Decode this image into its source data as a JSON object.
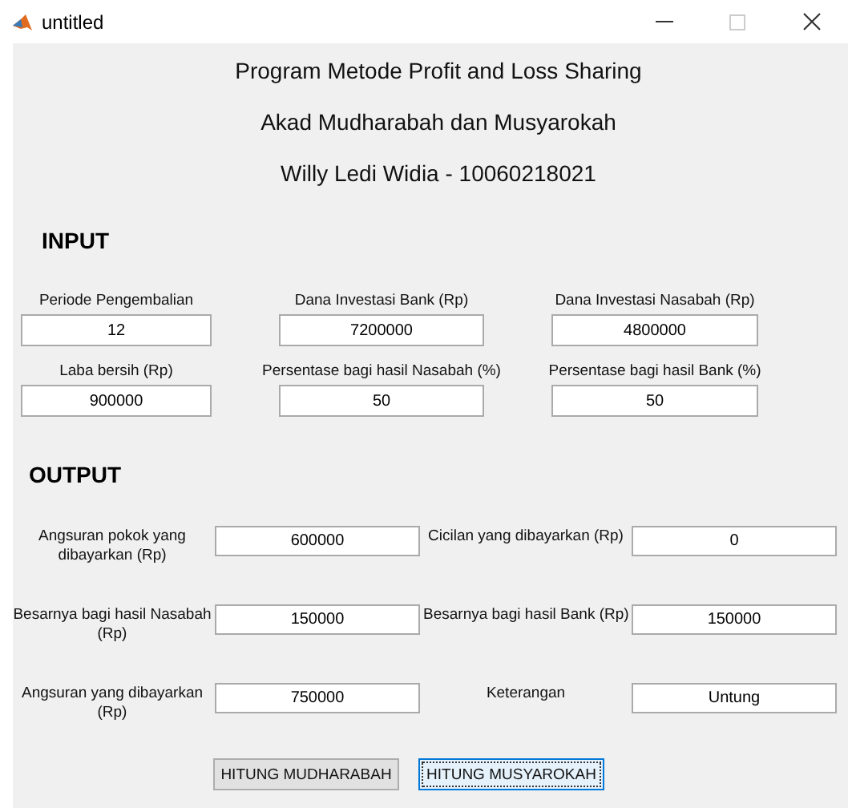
{
  "window": {
    "title": "untitled"
  },
  "titles": [
    "Program Metode Profit and Loss Sharing",
    "Akad Mudharabah dan Musyarokah",
    "Willy Ledi Widia - 10060218021"
  ],
  "input": {
    "heading": "INPUT",
    "fields": [
      {
        "label": "Periode Pengembalian",
        "value": "12"
      },
      {
        "label": "Dana Investasi Bank (Rp)",
        "value": "7200000"
      },
      {
        "label": "Dana Investasi Nasabah (Rp)",
        "value": "4800000"
      },
      {
        "label": "Laba bersih (Rp)",
        "value": "900000"
      },
      {
        "label": "Persentase bagi hasil Nasabah (%)",
        "value": "50"
      },
      {
        "label": "Persentase bagi hasil Bank (%)",
        "value": "50"
      }
    ]
  },
  "output": {
    "heading": "OUTPUT",
    "fields": [
      {
        "label": "Angsuran pokok yang dibayarkan (Rp)",
        "value": "600000"
      },
      {
        "label": "Cicilan yang dibayarkan (Rp)",
        "value": "0"
      },
      {
        "label": "Besarnya bagi hasil Nasabah (Rp)",
        "value": "150000"
      },
      {
        "label": "Besarnya bagi hasil Bank (Rp)",
        "value": "150000"
      },
      {
        "label": "Angsuran yang dibayarkan (Rp)",
        "value": "750000"
      },
      {
        "label": "Keterangan",
        "value": "Untung"
      }
    ]
  },
  "buttons": [
    {
      "label": "HITUNG MUDHARABAH",
      "focused": false
    },
    {
      "label": "HITUNG MUSYAROKAH",
      "focused": true
    }
  ]
}
